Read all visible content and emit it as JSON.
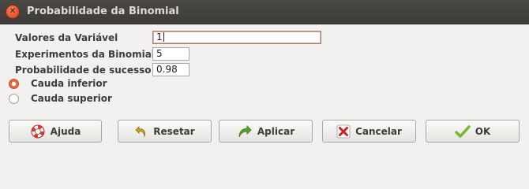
{
  "window": {
    "title": "Probabilidade da Binomial"
  },
  "form": {
    "valores_label": "Valores da Variável",
    "valores_value": "1",
    "experimentos_label": "Experimentos da Binomial",
    "experimentos_value": "5",
    "probabilidade_label": "Probabilidade de sucesso",
    "probabilidade_value": "0.98"
  },
  "tail": {
    "inferior_label": "Cauda inferior",
    "superior_label": "Cauda superior",
    "selected": "inferior"
  },
  "buttons": {
    "ajuda": "Ajuda",
    "resetar": "Resetar",
    "aplicar": "Aplicar",
    "cancelar": "Cancelar",
    "ok": "OK"
  },
  "icons": {
    "close": "close-icon",
    "ajuda": "lifebuoy-icon",
    "resetar": "undo-arrow-icon",
    "aplicar": "redo-arrow-icon",
    "cancelar": "red-x-icon",
    "ok": "checkmark-icon"
  },
  "colors": {
    "accent": "#e9643b",
    "titlebar": "#3c3b37"
  }
}
